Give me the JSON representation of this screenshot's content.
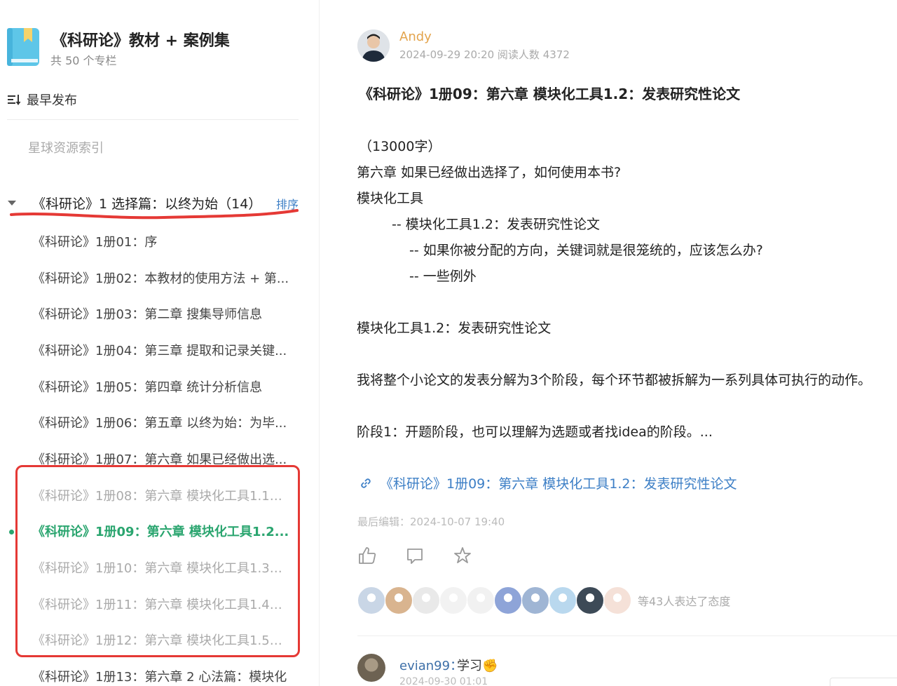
{
  "sidebar": {
    "book_title": "《科研论》教材 + 案例集",
    "book_subtitle": "共 50 个专栏",
    "sort_label": "最早发布",
    "resource_index": "星球资源索引",
    "group": {
      "title": "《科研论》1 选择篇：以终为始（14）",
      "sort_link": "排序"
    },
    "items": [
      {
        "label": "《科研论》1册01：序",
        "state": "normal"
      },
      {
        "label": "《科研论》1册02：本教材的使用方法 + 第...",
        "state": "normal"
      },
      {
        "label": "《科研论》1册03：第二章 搜集导师信息",
        "state": "normal"
      },
      {
        "label": "《科研论》1册04：第三章 提取和记录关键...",
        "state": "normal"
      },
      {
        "label": "《科研论》1册05：第四章 统计分析信息",
        "state": "normal"
      },
      {
        "label": "《科研论》1册06：第五章 以终为始：为毕...",
        "state": "normal"
      },
      {
        "label": "《科研论》1册07：第六章 如果已经做出选...",
        "state": "normal"
      },
      {
        "label": "《科研论》1册08：第六章 模块化工具1.1：...",
        "state": "faded"
      },
      {
        "label": "《科研论》1册09：第六章 模块化工具1.2...",
        "state": "active"
      },
      {
        "label": "《科研论》1册10：第六章 模块化工具1.3：...",
        "state": "faded"
      },
      {
        "label": "《科研论》1册11：第六章 模块化工具1.4：...",
        "state": "faded"
      },
      {
        "label": "《科研论》1册12：第六章 模块化工具1.5：...",
        "state": "faded"
      },
      {
        "label": "《科研论》1册13：第六章 2 心法篇：模块化",
        "state": "normal"
      }
    ]
  },
  "post": {
    "author": "Andy",
    "meta": "2024-09-29 20:20   阅读人数 4372",
    "title": "《科研论》1册09：第六章 模块化工具1.2：发表研究性论文",
    "body": [
      "（13000字）",
      "第六章 如果已经做出选择了，如何使用本书?",
      "模块化工具",
      "-- 模块化工具1.2：发表研究性论文",
      "-- 如果你被分配的方向，关键词就是很笼统的，应该怎么办?",
      "-- 一些例外",
      "模块化工具1.2：发表研究性论文",
      "我将整个小论文的发表分解为3个阶段，每个环节都被拆解为一系列具体可执行的动作。",
      "阶段1：开题阶段，也可以理解为选题或者找idea的阶段。..."
    ],
    "link_text": "《科研论》1册09：第六章 模块化工具1.2：发表研究性论文",
    "last_edited": "最后编辑：2024-10-07 19:40",
    "reactions_text": "等43人表达了态度",
    "reactor_colors": [
      "#c9d6e6",
      "#d9b48f",
      "#e9e9e9",
      "#f2f2f2",
      "#f1f1f1",
      "#8ea4d8",
      "#9fb5d4",
      "#b9d8ee",
      "#3d4a57",
      "#f5e1d8"
    ]
  },
  "comment": {
    "user": "evian99：",
    "text": "学习✊",
    "date": "2024-09-30 01:01"
  },
  "colors": {
    "accent_green": "#2aa56f",
    "link_blue": "#3d7fc6",
    "author_orange": "#e3a44d",
    "annotation_red": "#e53935"
  }
}
